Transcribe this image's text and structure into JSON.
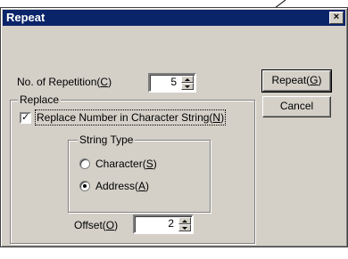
{
  "window": {
    "title": "Repeat",
    "close_glyph": "×"
  },
  "repetition": {
    "label": "No. of Repetition(",
    "key": "C",
    "close": ")",
    "value": "5"
  },
  "buttons": {
    "repeat": {
      "label": "Repeat(",
      "key": "G",
      "close": ")"
    },
    "cancel": {
      "label": "Cancel"
    }
  },
  "replace_group": {
    "legend": "Replace",
    "checkbox": {
      "label": "Replace Number in Character String(",
      "key": "N",
      "close": ")",
      "checked": true,
      "glyph": "✓"
    }
  },
  "string_type": {
    "legend": "String Type",
    "character": {
      "label": "Character(",
      "key": "S",
      "close": ")",
      "selected": false
    },
    "address": {
      "label": "Address(",
      "key": "A",
      "close": ")",
      "selected": true
    }
  },
  "offset": {
    "label": "Offset(",
    "key": "O",
    "close": ")",
    "value": "2"
  }
}
